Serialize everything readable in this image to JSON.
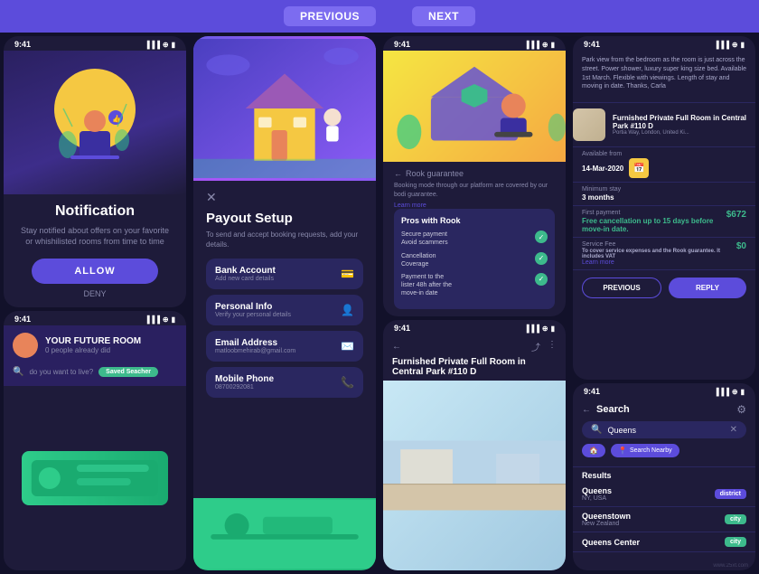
{
  "topNav": {
    "previous": "PREVIOUS",
    "next": "NEXT"
  },
  "col1": {
    "notification": {
      "statusTime": "9:41",
      "title": "Notification",
      "description": "Stay notified about offers on your favorite or whishilisted rooms from time to time",
      "allowLabel": "ALLOW",
      "denyLabel": "DENY"
    },
    "futureRoom": {
      "statusTime": "9:41",
      "title": "YOUR FUTURE ROOM",
      "subtitle": "0 people already did",
      "searchPlaceholder": "do you want to live?",
      "savedBadge": "Saved Seacher",
      "icons": [
        "search",
        "mail"
      ]
    }
  },
  "col2": {
    "payout": {
      "statusTime": "9:41",
      "title": "Payout Setup",
      "description": "To send and accept booking requests, add your details.",
      "items": [
        {
          "label": "Bank Account",
          "sub": "Add new card details",
          "icon": "💳"
        },
        {
          "label": "Personal Info",
          "sub": "Verify your personal details",
          "icon": "👤"
        },
        {
          "label": "Email Address",
          "sub": "matloobmehirab@gmail.com",
          "icon": "✉️"
        },
        {
          "label": "Mobile Phone",
          "sub": "08700292081",
          "icon": "📞"
        }
      ]
    }
  },
  "col3": {
    "rook": {
      "statusTime": "9:41",
      "backLabel": "← Rook guarantee",
      "title": "Rook guarantee",
      "description": "Booking mode through our platform are covered by our bodi guarantee.",
      "learnMore": "Learn more",
      "prosTitle": "Pros with Rook",
      "pros": [
        {
          "text": "Secure payment\nAvoid scammers"
        },
        {
          "text": "Cancellation\nCoverage"
        },
        {
          "text": "Payment to the\nlister 48h after the\nmove-in date"
        }
      ]
    },
    "furnished": {
      "statusTime": "9:41",
      "title": "Furnished Private Full Room in Central Park #110 D",
      "icons": [
        "share",
        "more"
      ]
    }
  },
  "col4": {
    "listing": {
      "statusTime": "9:41",
      "topText": "Park view from the bedroom as the room is just across the street. Power shower, luxury super king size bed. Available 1st March. Flexible with viewings. Length of stay and moving in date. Thanks, Carla",
      "card": {
        "title": "Furnished Private Full Room in Central Park #110 D",
        "sub": "Portia Way, London, United Ki..."
      },
      "availableFrom": {
        "label": "Available from",
        "value": "14-Mar-2020",
        "iconColor": "#f5c842"
      },
      "minimumStay": {
        "label": "Minimum stay",
        "value": "3 months"
      },
      "firstPayment": {
        "label": "First payment",
        "desc": "Free cancellation up to 15 days before move-in date.",
        "price": "$672"
      },
      "serviceFee": {
        "label": "Service Fee",
        "desc": "To cover service expenses and the Rook guarantee. It includes VAT",
        "learnMore": "Learn more",
        "price": "$0"
      },
      "previousLabel": "PREVIOUS",
      "replyLabel": "REPLY"
    },
    "search": {
      "statusTime": "9:41",
      "title": "Search",
      "filterIcon": "⚙",
      "query": "Queens",
      "pills": [
        {
          "icon": "🏠",
          "label": "",
          "active": true
        },
        {
          "icon": "📍",
          "label": "Search Nearby",
          "active": true
        }
      ],
      "resultsLabel": "Results",
      "results": [
        {
          "name": "Queens",
          "sub": "NY, USA",
          "badgeType": "district",
          "badgeLabel": "district"
        },
        {
          "name": "Queenstown",
          "sub": "New Zealand",
          "badgeType": "city",
          "badgeLabel": "city"
        },
        {
          "name": "Queens Center",
          "sub": "",
          "badgeType": "city",
          "badgeLabel": "city"
        }
      ]
    }
  },
  "watermark": "www.25xt.com"
}
